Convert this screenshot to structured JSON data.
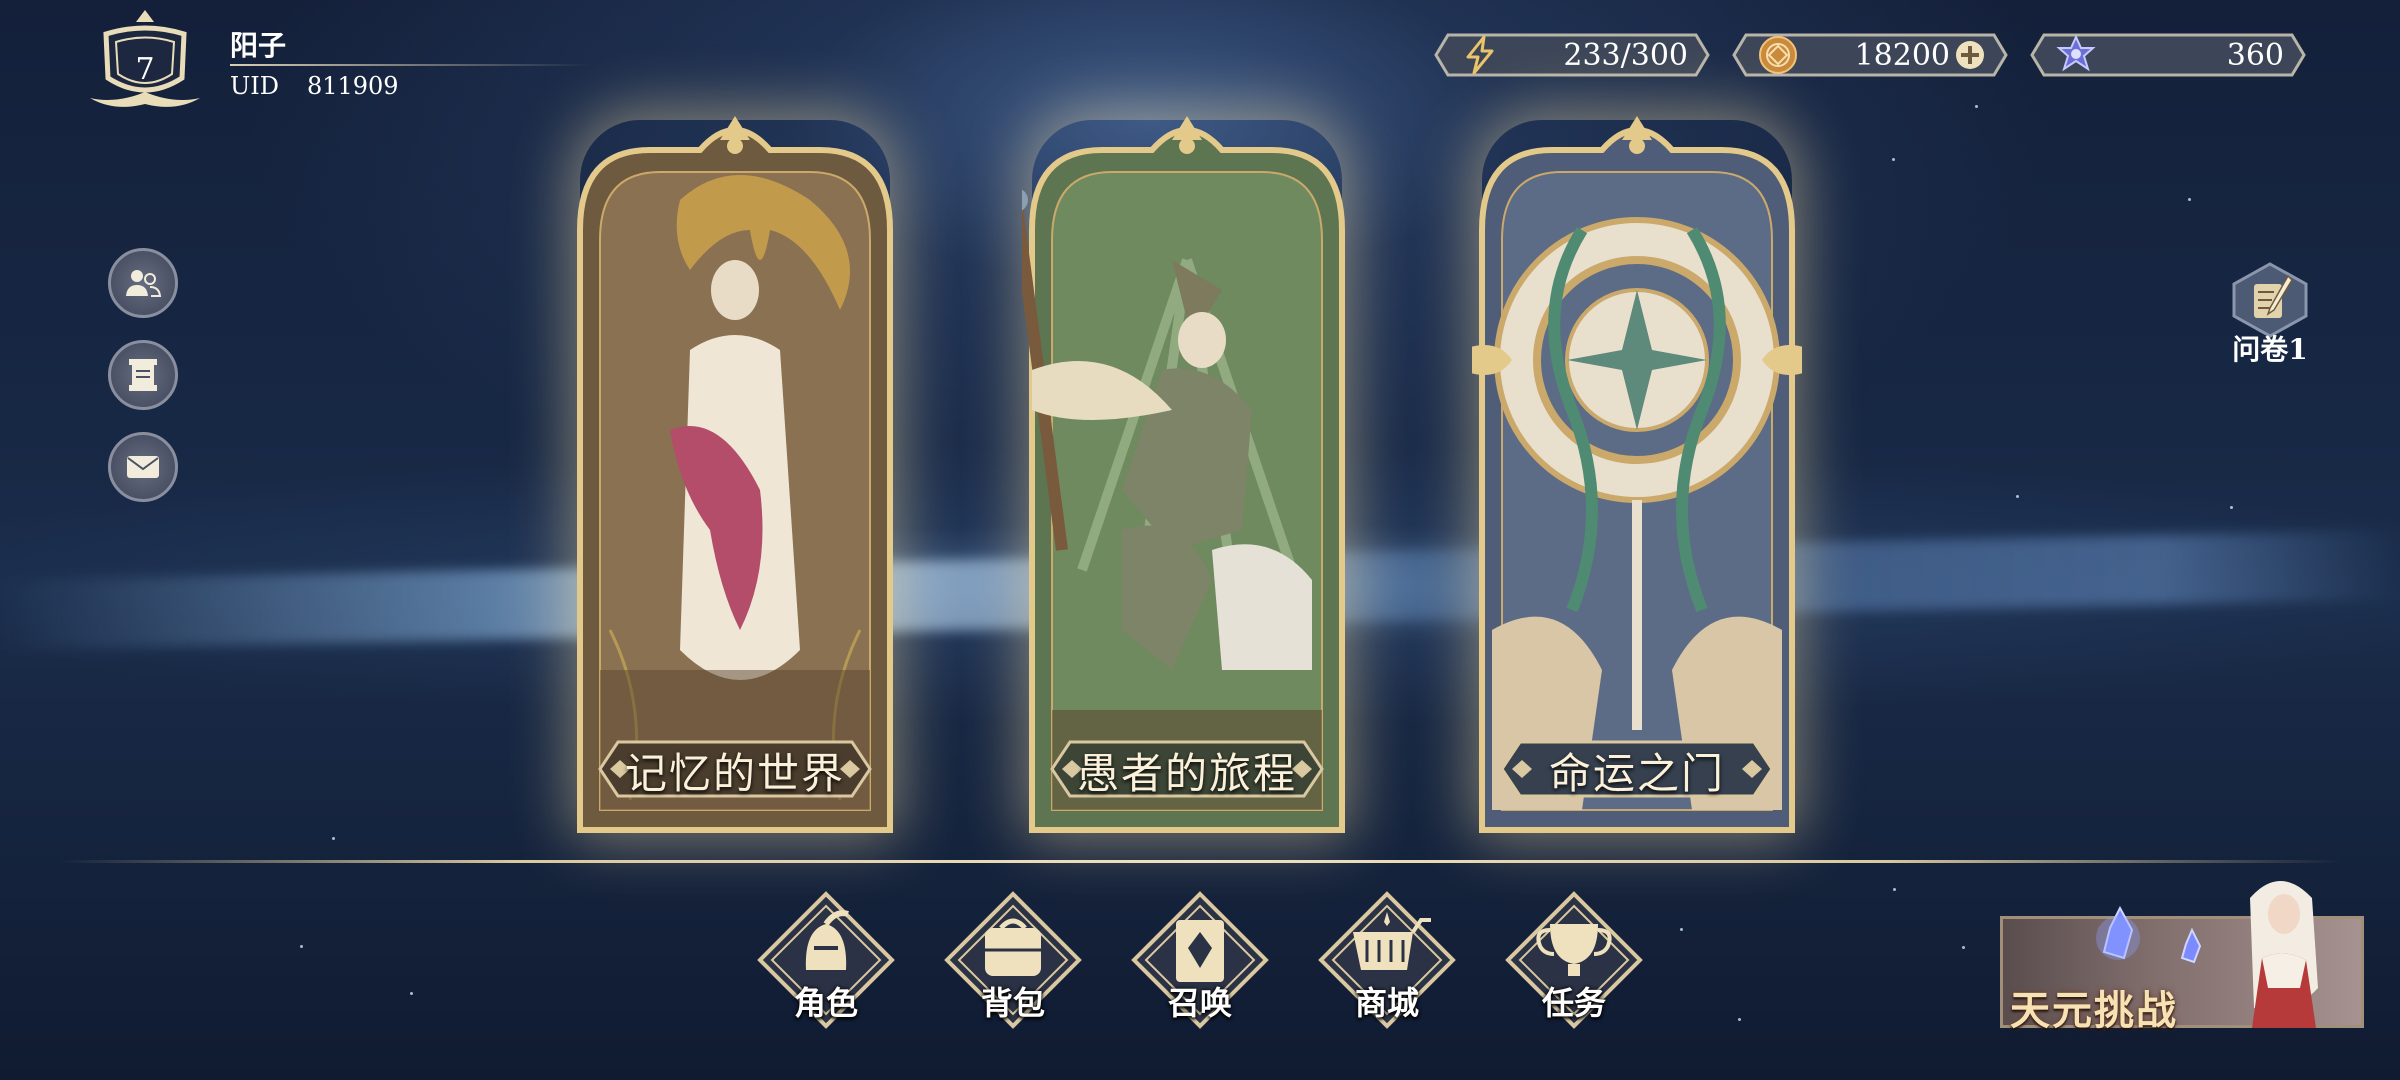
{
  "player": {
    "level": "7",
    "name": "阳子",
    "uid_label": "UID",
    "uid": "811909"
  },
  "resources": {
    "stamina": {
      "icon": "lightning-icon",
      "value": "233/300"
    },
    "coins": {
      "icon": "coin-icon",
      "value": "18200",
      "has_plus": true
    },
    "gems": {
      "icon": "star-gem-icon",
      "value": "360"
    }
  },
  "side_menu": [
    {
      "name": "friends",
      "icon": "friends-icon"
    },
    {
      "name": "scroll",
      "icon": "scroll-icon"
    },
    {
      "name": "mail",
      "icon": "mail-icon"
    }
  ],
  "survey": {
    "label": "问卷1",
    "icon": "quill-note-icon"
  },
  "cards": [
    {
      "title": "记忆的世界",
      "theme": "#6e5a3e",
      "accent": "#e3c98a"
    },
    {
      "title": "愚者的旅程",
      "theme": "#5d7550",
      "accent": "#e3c98a"
    },
    {
      "title": "命运之门",
      "theme": "#4f5d78",
      "accent": "#e3c98a"
    }
  ],
  "nav": [
    {
      "label": "角色",
      "icon": "knight-helmet-icon"
    },
    {
      "label": "背包",
      "icon": "backpack-icon"
    },
    {
      "label": "召唤",
      "icon": "summon-card-icon"
    },
    {
      "label": "商城",
      "icon": "shopping-cart-icon"
    },
    {
      "label": "任务",
      "icon": "trophy-icon"
    }
  ],
  "event_banner": {
    "label": "天元挑战"
  },
  "colors": {
    "gold": "#e3c98a",
    "frame": "#d9c8a0",
    "bg": "#172845"
  }
}
